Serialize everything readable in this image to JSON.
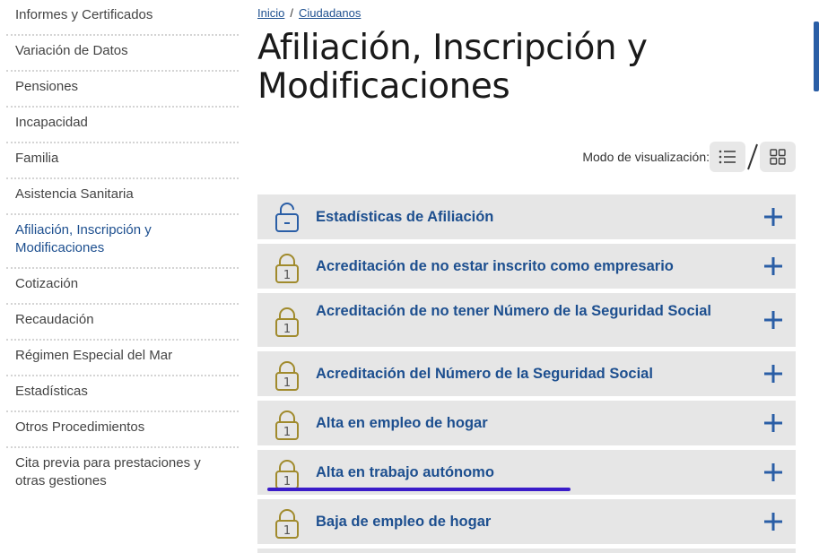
{
  "sidebar": {
    "items": [
      {
        "label": "Informes y Certificados"
      },
      {
        "label": "Variación de Datos"
      },
      {
        "label": "Pensiones"
      },
      {
        "label": "Incapacidad"
      },
      {
        "label": "Familia"
      },
      {
        "label": "Asistencia Sanitaria"
      },
      {
        "label": "Afiliación, Inscripción y Modificaciones",
        "active": true
      },
      {
        "label": "Cotización"
      },
      {
        "label": "Recaudación"
      },
      {
        "label": "Régimen Especial del Mar"
      },
      {
        "label": "Estadísticas"
      },
      {
        "label": "Otros Procedimientos"
      },
      {
        "label": "Cita previa para prestaciones y otras gestiones"
      }
    ]
  },
  "breadcrumb": {
    "home": "Inicio",
    "separator": "/",
    "section": "Ciudadanos"
  },
  "page": {
    "title": "Afiliación, Inscripción y Modificaciones"
  },
  "view_mode": {
    "label": "Modo de visualización:",
    "separator": "/",
    "list_icon": "list-icon",
    "grid_icon": "grid-icon"
  },
  "procedures": [
    {
      "title": "Estadísticas de Afiliación",
      "icon": "unlock-icon",
      "access_level": ""
    },
    {
      "title": "Acreditación de no estar inscrito como empresario",
      "icon": "lock-icon",
      "access_level": "1"
    },
    {
      "title": "Acreditación de no tener Número de la Seguridad Social",
      "icon": "lock-icon",
      "access_level": "1"
    },
    {
      "title": "Acreditación del Número de la Seguridad Social",
      "icon": "lock-icon",
      "access_level": "1"
    },
    {
      "title": "Alta en empleo de hogar",
      "icon": "lock-icon",
      "access_level": "1"
    },
    {
      "title": "Alta en trabajo autónomo",
      "icon": "lock-icon",
      "access_level": "1"
    },
    {
      "title": "Baja de empleo de hogar",
      "icon": "lock-icon",
      "access_level": "1"
    }
  ],
  "colors": {
    "link": "#1d4f8f",
    "row_bg": "#e6e6e6",
    "lock_gold": "#a08a2c",
    "unlock_blue": "#2a5ea6",
    "highlight": "#3a1cc9"
  }
}
